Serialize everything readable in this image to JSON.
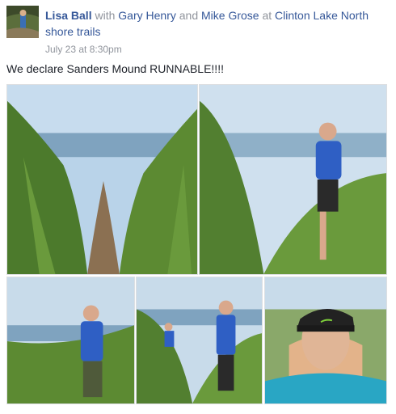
{
  "post": {
    "author": "Lisa Ball",
    "with_word": "with",
    "tagged_1": "Gary Henry",
    "and_word": "and",
    "tagged_2": "Mike Grose",
    "at_word": "at",
    "location": "Clinton Lake North shore trails",
    "timestamp": "July 23 at 8:30pm",
    "text": "We declare Sanders Mound RUNNABLE!!!!"
  },
  "photos": [
    {
      "subject": "trail-through-tall-grass"
    },
    {
      "subject": "runner-in-blue-shirt-on-trail"
    },
    {
      "subject": "runner-on-trail-by-lake"
    },
    {
      "subject": "runners-on-trail-in-grass"
    },
    {
      "subject": "selfie-with-nike-cap"
    }
  ],
  "colors": {
    "link": "#365899",
    "meta": "#90949c",
    "text": "#1d2129"
  }
}
